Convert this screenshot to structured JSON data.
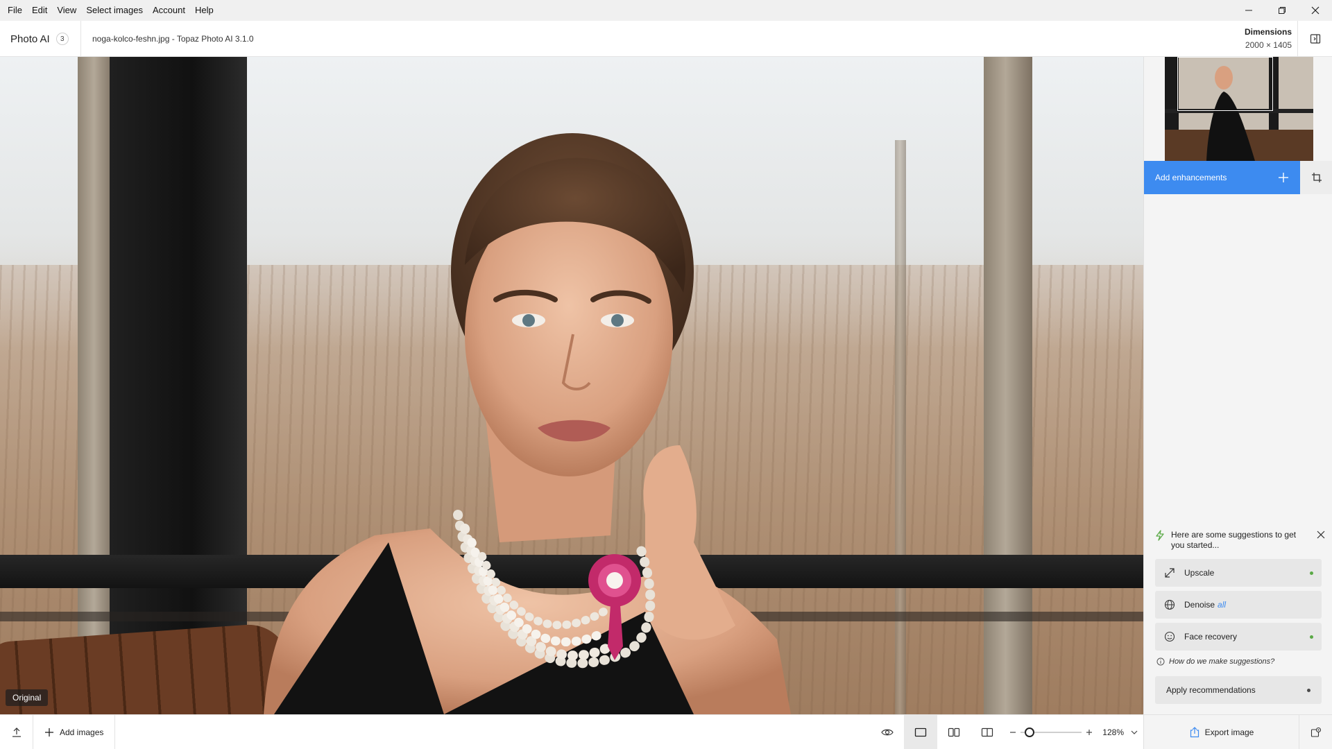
{
  "menu": {
    "items": [
      "File",
      "Edit",
      "View",
      "Select images",
      "Account",
      "Help"
    ]
  },
  "window_controls": {
    "minimize": "minimize-icon",
    "restore": "restore-icon",
    "close": "close-icon"
  },
  "header": {
    "app_name": "Photo AI",
    "image_count": "3",
    "file_title": "noga-kolco-feshn.jpg - Topaz Photo AI 3.1.0",
    "dimensions_label": "Dimensions",
    "dimensions_value": "2000 × 1405"
  },
  "canvas": {
    "view_label": "Original"
  },
  "panel": {
    "add_enhancements_label": "Add enhancements",
    "suggestions_intro": "Here are some suggestions to get you started...",
    "suggestions": [
      {
        "label": "Upscale",
        "icon": "upscale-icon",
        "tag": ""
      },
      {
        "label": "Denoise",
        "icon": "denoise-icon",
        "tag": "all"
      },
      {
        "label": "Face recovery",
        "icon": "face-icon",
        "tag": ""
      }
    ],
    "how_link": "How do we make suggestions?",
    "apply_label": "Apply recommendations"
  },
  "bottom": {
    "add_images_label": "Add images",
    "zoom_value": "128%",
    "zoom_level": 0.14,
    "export_label": "Export image"
  },
  "colors": {
    "accent": "#3d8bf0",
    "status_green": "#5aa946"
  }
}
